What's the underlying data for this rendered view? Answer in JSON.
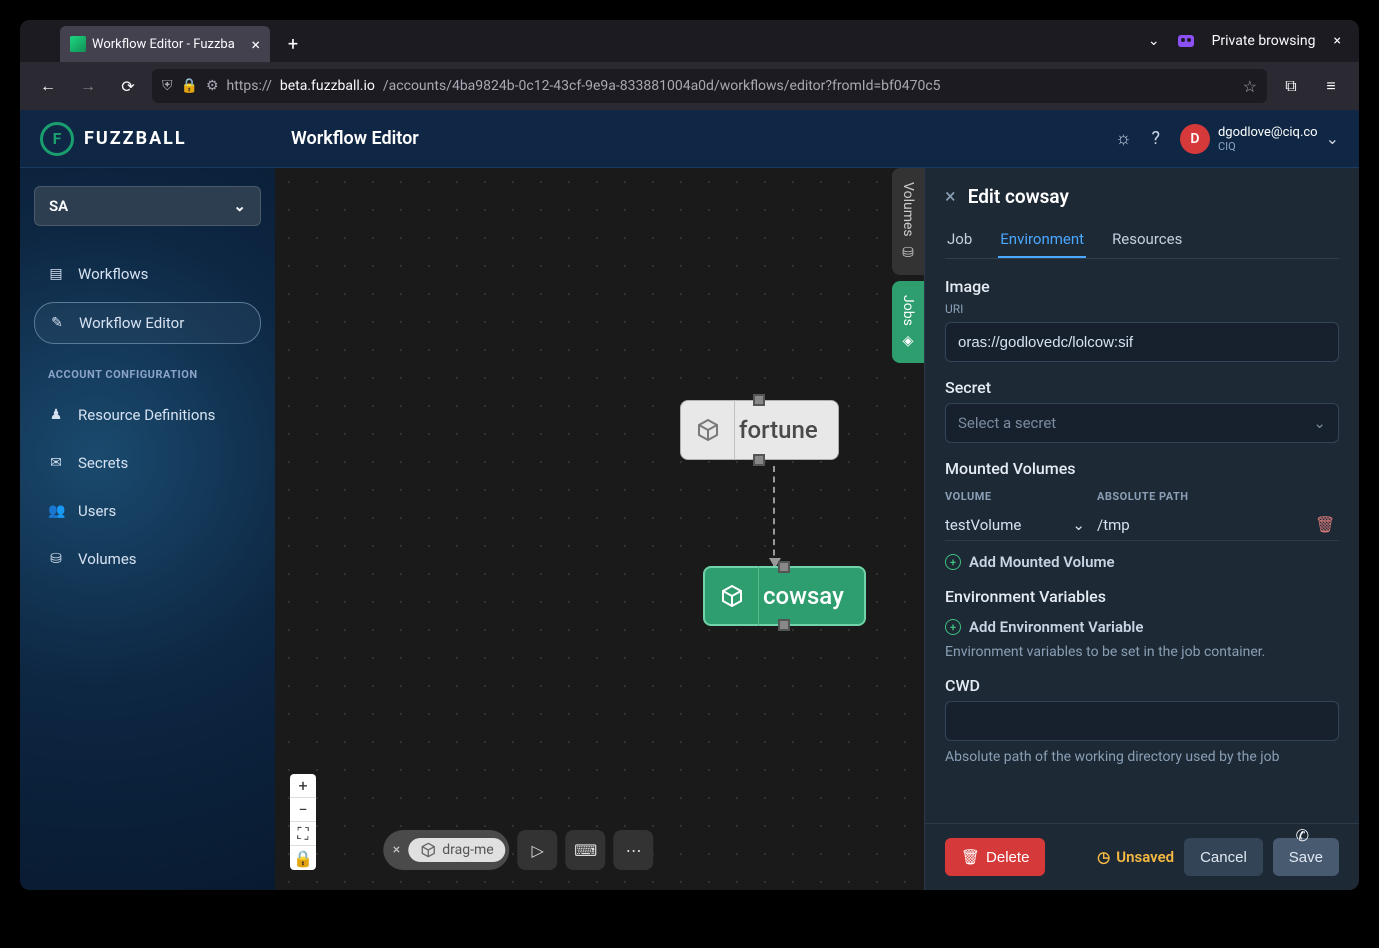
{
  "browser": {
    "tab_title": "Workflow Editor - Fuzzba",
    "private_label": "Private browsing",
    "url_prefix": "https://",
    "url_host": "beta.fuzzball.io",
    "url_path": "/accounts/4ba9824b-0c12-43cf-9e9a-833881004a0d/workflows/editor?fromId=bf0470c5"
  },
  "header": {
    "brand": "FUZZBALL",
    "page_title": "Workflow Editor",
    "user_email": "dgodlove@ciq.co",
    "user_org": "CIQ",
    "avatar_initial": "D"
  },
  "sidebar": {
    "context": "SA",
    "items": [
      {
        "label": "Workflows",
        "icon": "▤"
      },
      {
        "label": "Workflow Editor",
        "icon": "✎",
        "active": true
      }
    ],
    "section": "ACCOUNT CONFIGURATION",
    "config_items": [
      {
        "label": "Resource Definitions",
        "icon": "♟"
      },
      {
        "label": "Secrets",
        "icon": "✉"
      },
      {
        "label": "Users",
        "icon": "👥"
      },
      {
        "label": "Volumes",
        "icon": "⛁"
      }
    ]
  },
  "canvas": {
    "node_fortune": "fortune",
    "node_cowsay": "cowsay",
    "drag_label": "drag-me",
    "side_volumes": "Volumes",
    "side_jobs": "Jobs"
  },
  "panel": {
    "title": "Edit cowsay",
    "tabs": {
      "job": "Job",
      "env": "Environment",
      "res": "Resources"
    },
    "image_label": "Image",
    "uri_label": "URI",
    "uri_value": "oras://godlovedc/lolcow:sif",
    "secret_label": "Secret",
    "secret_placeholder": "Select a secret",
    "mounted_label": "Mounted Volumes",
    "col_volume": "VOLUME",
    "col_path": "ABSOLUTE PATH",
    "vol_name": "testVolume",
    "vol_path": "/tmp",
    "add_vol": "Add Mounted Volume",
    "envvar_label": "Environment Variables",
    "add_env": "Add Environment Variable",
    "env_help": "Environment variables to be set in the job container.",
    "cwd_label": "CWD",
    "cwd_value": "",
    "cwd_help": "Absolute path of the working directory used by the job",
    "delete": "Delete",
    "unsaved": "Unsaved",
    "cancel": "Cancel",
    "save": "Save"
  }
}
